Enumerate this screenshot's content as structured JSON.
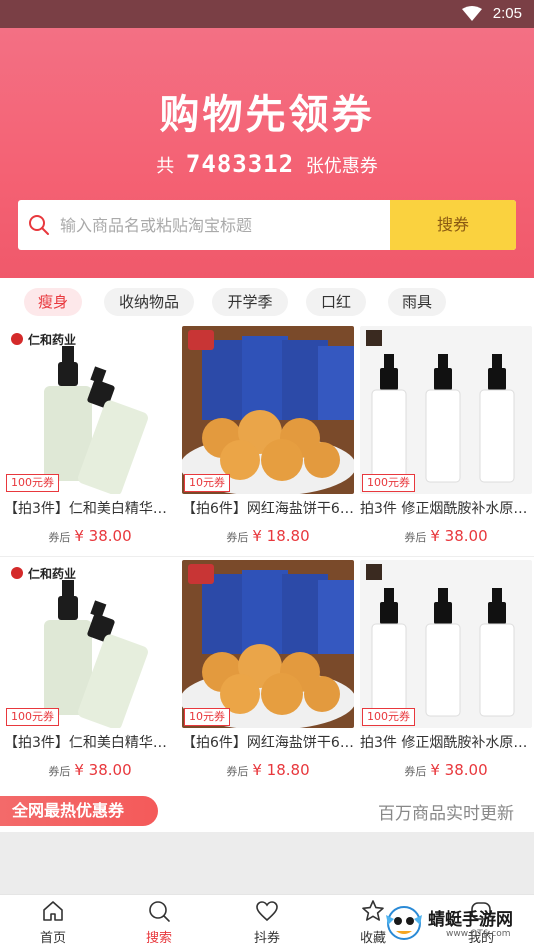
{
  "status_bar": {
    "time": "2:05"
  },
  "hero": {
    "title": "购物先领券",
    "sub_prefix": "共",
    "count": "7483312",
    "sub_suffix": "张优惠券"
  },
  "search": {
    "placeholder": "输入商品名或粘贴淘宝标题",
    "button_label": "搜券"
  },
  "tags": [
    {
      "label": "瘦身",
      "active": true
    },
    {
      "label": "收纳物品",
      "active": false
    },
    {
      "label": "开学季",
      "active": false
    },
    {
      "label": "口红",
      "active": false
    },
    {
      "label": "雨具",
      "active": false
    }
  ],
  "products": [
    {
      "name": "【拍3件】仁和美白精华…",
      "coupon": "100元券",
      "after_label": "券后",
      "price": "¥ 38.00",
      "brand_text": "仁和药业",
      "image": "serum-bottles"
    },
    {
      "name": "【拍6件】网红海盐饼干6…",
      "coupon": "10元券",
      "after_label": "券后",
      "price": "¥ 18.80",
      "brand_text": "",
      "image": "biscuits"
    },
    {
      "name": "拍3件 修正烟酰胺补水原…",
      "coupon": "100元券",
      "after_label": "券后",
      "price": "¥ 38.00",
      "brand_text": "",
      "image": "white-bottles"
    },
    {
      "name": "【拍3件】仁和美白精华…",
      "coupon": "100元券",
      "after_label": "券后",
      "price": "¥ 38.00",
      "brand_text": "仁和药业",
      "image": "serum-bottles"
    },
    {
      "name": "【拍6件】网红海盐饼干6…",
      "coupon": "10元券",
      "after_label": "券后",
      "price": "¥ 18.80",
      "brand_text": "",
      "image": "biscuits"
    },
    {
      "name": "拍3件 修正烟酰胺补水原…",
      "coupon": "100元券",
      "after_label": "券后",
      "price": "¥ 38.00",
      "brand_text": "",
      "image": "white-bottles"
    }
  ],
  "hot_bar": {
    "left_label": "全网最热优惠券",
    "right_label": "百万商品实时更新"
  },
  "tabbar": [
    {
      "label": "首页",
      "icon": "home-icon",
      "active": false
    },
    {
      "label": "搜索",
      "icon": "search-icon",
      "active": true
    },
    {
      "label": "抖券",
      "icon": "heart-icon",
      "active": false
    },
    {
      "label": "收藏",
      "icon": "star-icon",
      "active": false
    },
    {
      "label": "我的",
      "icon": "user-icon",
      "active": false
    }
  ],
  "watermark": {
    "text": "蜻蜓手游网",
    "url": "www.QT6.com"
  },
  "colors": {
    "accent": "#e8383d",
    "hero": "#f46173",
    "search_button": "#fad23f"
  }
}
